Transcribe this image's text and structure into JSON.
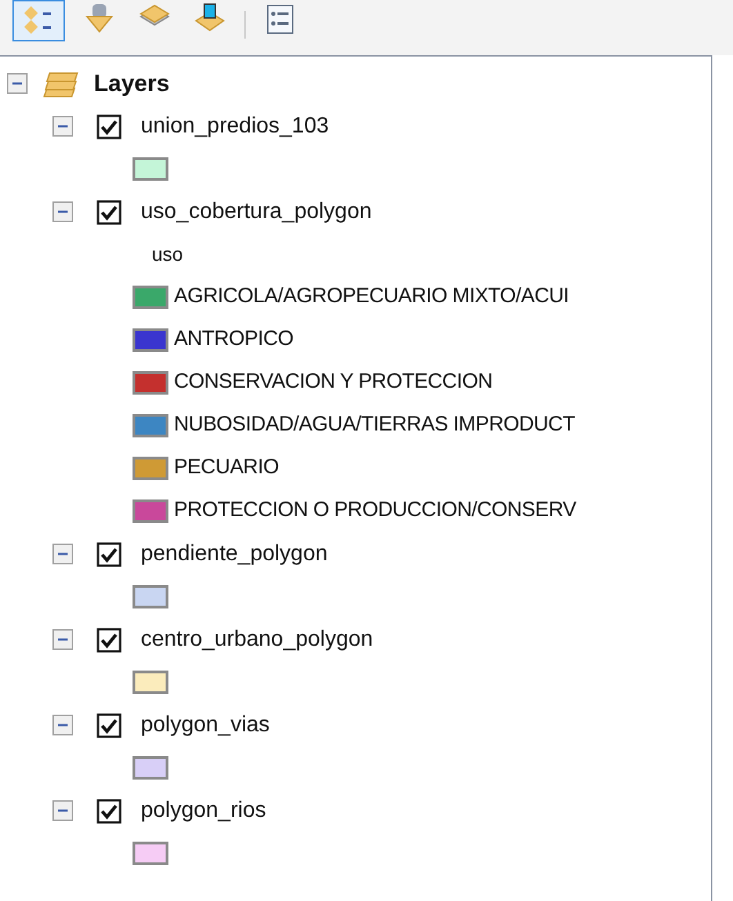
{
  "toolbar": [
    {
      "selected": true
    },
    {
      "selected": false
    },
    {
      "selected": false
    },
    {
      "selected": false
    },
    {
      "selected": false
    }
  ],
  "root": {
    "label": "Layers",
    "expanded": true,
    "children": [
      {
        "label": "union_predios_103",
        "expanded": true,
        "checked": true,
        "legend": [
          {
            "color": "#c4f5d8"
          }
        ]
      },
      {
        "label": "uso_cobertura_polygon",
        "expanded": true,
        "checked": true,
        "field": "uso",
        "legend": [
          {
            "label": "AGRICOLA/AGROPECUARIO MIXTO/ACUI",
            "color": "#3aa86a"
          },
          {
            "label": "ANTROPICO",
            "color": "#3a35cf"
          },
          {
            "label": "CONSERVACION Y PROTECCION",
            "color": "#c4302e"
          },
          {
            "label": "NUBOSIDAD/AGUA/TIERRAS IMPRODUCT",
            "color": "#3d86c2"
          },
          {
            "label": "PECUARIO",
            "color": "#cf9a35"
          },
          {
            "label": "PROTECCION O PRODUCCION/CONSERV",
            "color": "#c9489b"
          }
        ]
      },
      {
        "label": "pendiente_polygon",
        "expanded": true,
        "checked": true,
        "legend": [
          {
            "color": "#c9d6f2"
          }
        ]
      },
      {
        "label": "centro_urbano_polygon",
        "expanded": true,
        "checked": true,
        "legend": [
          {
            "color": "#fbecbc"
          }
        ]
      },
      {
        "label": "polygon_vias",
        "expanded": true,
        "checked": true,
        "legend": [
          {
            "color": "#d8cff7"
          }
        ]
      },
      {
        "label": "polygon_rios",
        "expanded": true,
        "checked": true,
        "legend": [
          {
            "color": "#f6ccf5"
          }
        ]
      }
    ]
  }
}
